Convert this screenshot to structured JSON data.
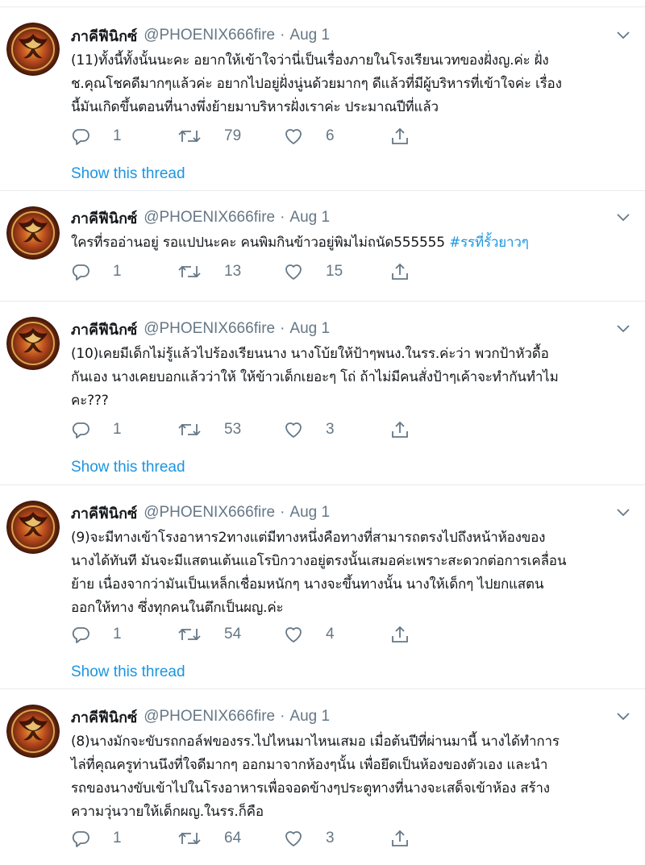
{
  "tweets": [
    {
      "name": "ภาคีฟีนิกซ์",
      "handle": "@PHOENIX666fire",
      "separator": "·",
      "date": "Aug 1",
      "lines": [
        "(11)ทั้งนี้ทั้งนั้นนะคะ อยากให้เข้าใจว่านี่เป็นเรื่องภายในโรงเรียนเวทของฝั่งญ.ค่ะ ฝั่ง",
        "ช.คุณโชคดีมากๆแล้วค่ะ อยากไปอยู่ฝั่งนู่นด้วยมากๆ ดีแล้วที่มีผู้บริหารที่เข้าใจค่ะ เรื่อง",
        "นี้มันเกิดขึ้นตอนที่นางพึ่งย้ายมาบริหารฝั่งเราค่ะ ประมาณปีที่แล้ว"
      ],
      "hashtag": "",
      "replies": "1",
      "retweets": "79",
      "likes": "6",
      "show_thread": "Show this thread"
    },
    {
      "name": "ภาคีฟีนิกซ์",
      "handle": "@PHOENIX666fire",
      "separator": "·",
      "date": "Aug 1",
      "lines": [
        "ใครที่รออ่านอยู่  รอแปปนะคะ คนพิมกินข้าวอยู่พิมไม่ถนัด555555 "
      ],
      "hashtag": "#รรที่รั้วยาวๆ",
      "replies": "1",
      "retweets": "13",
      "likes": "15",
      "show_thread": ""
    },
    {
      "name": "ภาคีฟีนิกซ์",
      "handle": "@PHOENIX666fire",
      "separator": "·",
      "date": "Aug 1",
      "lines": [
        "(10)เคยมีเด็กไม่รู้แล้วไปร้องเรียนนาง นางโบ้ยให้ป้าๆพนง.ในรร.ค่ะว่า พวกป้าหัวดื้อ",
        "กันเอง นางเคยบอกแล้วว่าให้ ให้ข้าวเด็กเยอะๆ โถ่ ถ้าไม่มีคนสั่งป้าๆเค้าจะทำกันทำไม",
        "คะ???"
      ],
      "hashtag": "",
      "replies": "1",
      "retweets": "53",
      "likes": "3",
      "show_thread": "Show this thread"
    },
    {
      "name": "ภาคีฟีนิกซ์",
      "handle": "@PHOENIX666fire",
      "separator": "·",
      "date": "Aug 1",
      "lines": [
        "(9)จะมีทางเข้าโรงอาหาร2ทางแต่มีทางหนึ่งคือทางที่สามารถตรงไปถึงหน้าห้องของ",
        "นางได้ทันที มันจะมีแสตนเต้นแอโรบิกวางอยู่ตรงนั้นเสมอค่ะเพราะสะดวกต่อการเคลื่อน",
        "ย้าย เนื่องจากว่ามันเป็นเหล็กเชื่อมหนักๆ นางจะขึ้นทางนั้น นางให้เด็กๆ ไปยกแสตน",
        "ออกให้ทาง ซึ่งทุกคนในตึกเป็นผญ.ค่ะ"
      ],
      "hashtag": "",
      "replies": "1",
      "retweets": "54",
      "likes": "4",
      "show_thread": "Show this thread"
    },
    {
      "name": "ภาคีฟีนิกซ์",
      "handle": "@PHOENIX666fire",
      "separator": "·",
      "date": "Aug 1",
      "lines": [
        "(8)นางมักจะขับรถกอล์ฟของรร.ไปไหนมาไหนเสมอ เมื่อต้นปีที่ผ่านมานี้ นางได้ทำการ",
        "ไล่ที่คุณครูท่านนึงที่ใจดีมากๆ ออกมาจากห้องๆนั้น เพื่อยึดเป็นห้องของตัวเอง และนำ",
        "รถของนางขับเข้าไปในโรงอาหารเพื่อจอดข้างๆประตูทางที่นางจะเสด็จเข้าห้อง สร้าง",
        "ความวุ่นวายให้เด็กผญ.ในรร.ก็คือ"
      ],
      "hashtag": "",
      "replies": "1",
      "retweets": "64",
      "likes": "3",
      "show_thread": ""
    }
  ],
  "icons": {
    "reply": "reply-icon",
    "retweet": "retweet-icon",
    "like": "heart-icon",
    "share": "share-icon",
    "caret": "chevron-down-icon",
    "avatar": "phoenix-avatar"
  },
  "colors": {
    "text": "#14171a",
    "secondary": "#657786",
    "link": "#1b95e0",
    "divider": "#e6ecf0"
  }
}
